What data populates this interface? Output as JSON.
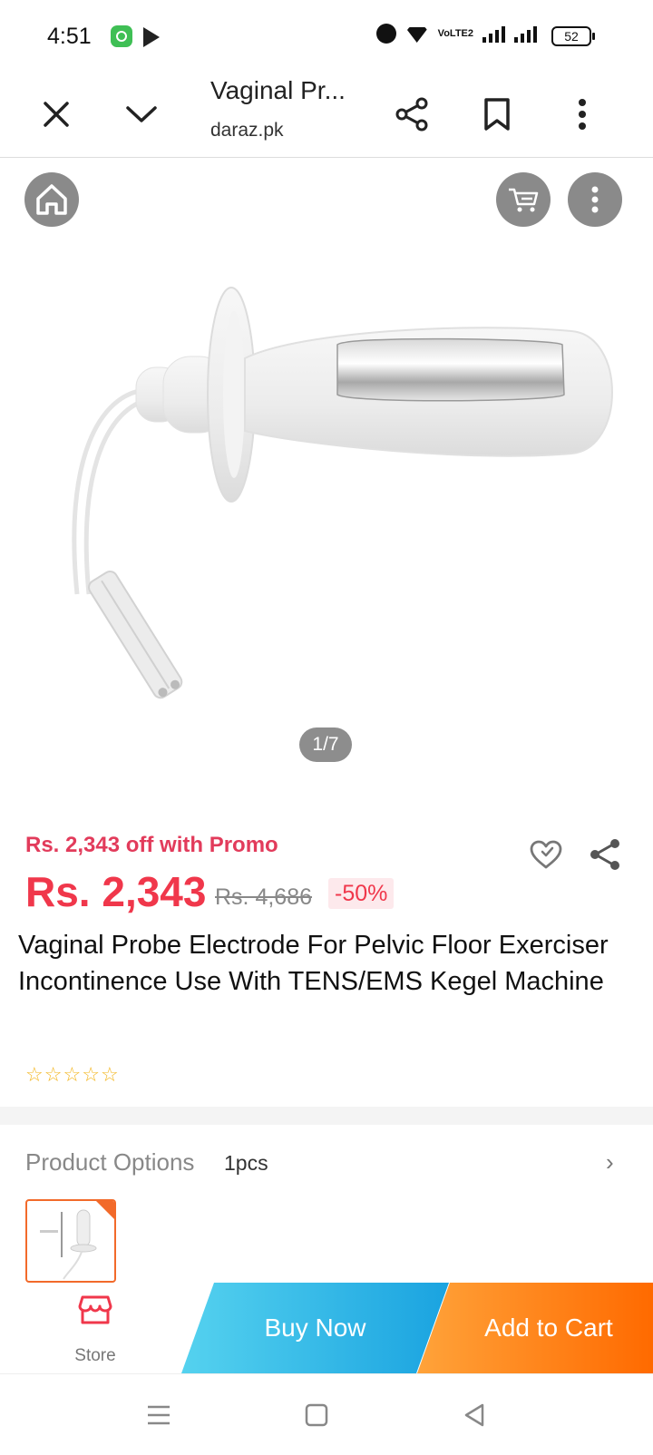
{
  "status_bar": {
    "time": "4:51",
    "network_label": "VoLTE2",
    "battery": "52"
  },
  "browser": {
    "page_title": "Vaginal Pr...",
    "domain": "daraz.pk"
  },
  "gallery": {
    "page_indicator": "1/7"
  },
  "product": {
    "promo_text": "Rs. 2,343 off with Promo",
    "price": "Rs. 2,343",
    "original_price": "Rs. 4,686",
    "discount": "-50%",
    "title": "Vaginal Probe Electrode For Pelvic Floor Exerciser Incontinence Use With TENS/EMS Kegel Machine",
    "rating_stars_filled": 0,
    "rating_stars_total": 5
  },
  "options": {
    "label": "Product Options",
    "value": "1pcs"
  },
  "actions": {
    "store_label": "Store",
    "buy_now_label": "Buy Now",
    "add_to_cart_label": "Add to Cart"
  },
  "colors": {
    "price_red": "#f0374b",
    "buy_now_blue": "#1aa3e0",
    "add_cart_orange": "#ff6a00",
    "star_yellow": "#f3b61f"
  },
  "icons": [
    "close-icon",
    "chevron-down-icon",
    "share-icon",
    "bookmark-icon",
    "more-vert-icon",
    "home-icon",
    "cart-icon",
    "heart-icon",
    "store-icon",
    "menu-icon",
    "square-icon",
    "back-icon"
  ]
}
